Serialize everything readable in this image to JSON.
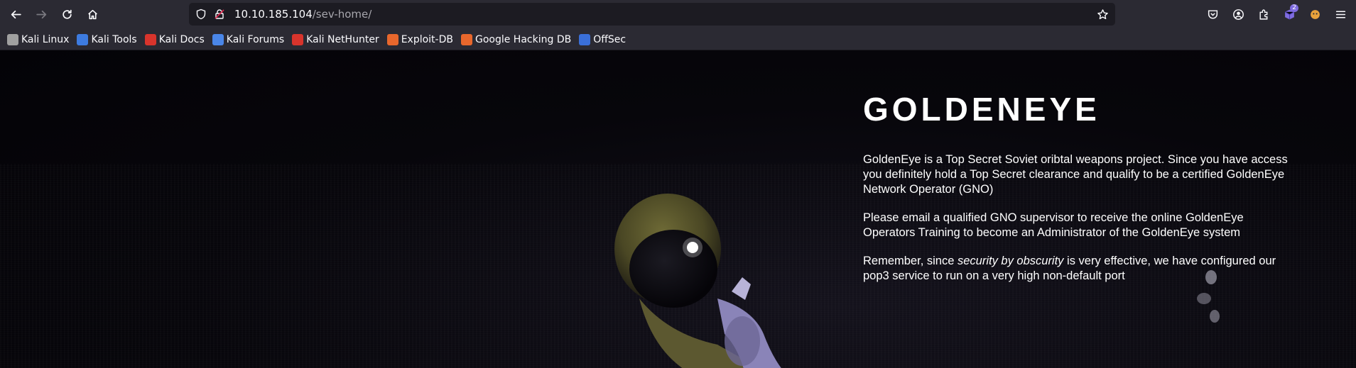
{
  "browser": {
    "url_host": "10.10.185.104",
    "url_path": "/sev-home/",
    "extension_badge": "2"
  },
  "bookmarks": [
    {
      "label": "Kali Linux",
      "icon": "kali-dragon-icon",
      "color": "#a0a0a0"
    },
    {
      "label": "Kali Tools",
      "icon": "kali-tools-icon",
      "color": "#3d7be0"
    },
    {
      "label": "Kali Docs",
      "icon": "kali-docs-icon",
      "color": "#d8342c"
    },
    {
      "label": "Kali Forums",
      "icon": "kali-forums-icon",
      "color": "#4a86e8"
    },
    {
      "label": "Kali NetHunter",
      "icon": "kali-nethunter-icon",
      "color": "#d8342c"
    },
    {
      "label": "Exploit-DB",
      "icon": "exploit-db-icon",
      "color": "#e8672c"
    },
    {
      "label": "Google Hacking DB",
      "icon": "ghdb-icon",
      "color": "#e8672c"
    },
    {
      "label": "OffSec",
      "icon": "offsec-icon",
      "color": "#3a6fd8"
    }
  ],
  "page": {
    "title": "GOLDENEYE",
    "para1": "GoldenEye is a Top Secret Soviet oribtal weapons project. Since you have access you definitely hold a Top Secret clearance and qualify to be a certified GoldenEye Network Operator (GNO)",
    "para2": "Please email a qualified GNO supervisor to receive the online GoldenEye Operators Training to become an Administrator of the GoldenEye system",
    "para3_pre": "Remember, since ",
    "para3_em": "security by obscurity",
    "para3_post": " is very effective, we have configured our pop3 service to run on a very high non-default port"
  }
}
